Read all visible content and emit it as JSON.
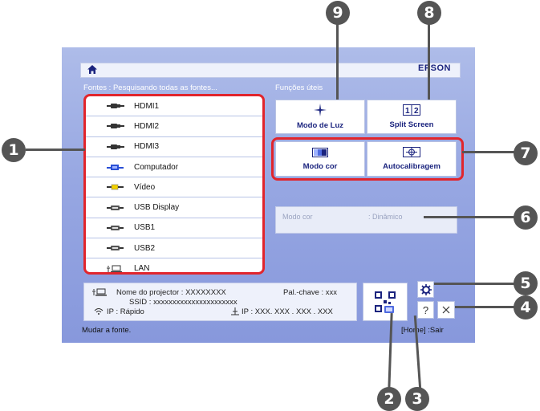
{
  "screen": {
    "brand": "EPSON",
    "sources_label": "Fontes : Pesquisando todas as fontes...",
    "functions_label": "Funções úteis",
    "status_text": "Mudar a fonte.",
    "home_exit": "[Home] :Sair"
  },
  "sources": [
    {
      "label": "HDMI1",
      "icon": "hdmi-icon"
    },
    {
      "label": "HDMI2",
      "icon": "hdmi-icon"
    },
    {
      "label": "HDMI3",
      "icon": "hdmi-icon"
    },
    {
      "label": "Computador",
      "icon": "computer-icon"
    },
    {
      "label": "Vídeo",
      "icon": "video-icon"
    },
    {
      "label": "USB Display",
      "icon": "usb-display-icon"
    },
    {
      "label": "USB1",
      "icon": "usb-icon"
    },
    {
      "label": "USB2",
      "icon": "usb-icon"
    },
    {
      "label": "LAN",
      "icon": "lan-icon"
    }
  ],
  "tiles": {
    "light_mode": "Modo de Luz",
    "split_screen": "Split Screen",
    "color_mode": "Modo cor",
    "auto_calibration": "Autocalibragem"
  },
  "color_mode_row": {
    "label": "Modo cor",
    "value": ": Dinâmico"
  },
  "info": {
    "projector_name": "Nome do projector : XXXXXXXX",
    "passkey": "Pal.-chave : xxx",
    "ssid": "SSID : xxxxxxxxxxxxxxxxxxxxxx",
    "ip_mode": "IP : Rápido",
    "ip_address": "IP : XXX. XXX . XXX . XXX"
  },
  "callouts": [
    "1",
    "2",
    "3",
    "4",
    "5",
    "6",
    "7",
    "8",
    "9"
  ],
  "colors": {
    "red": "#e1252c",
    "navy": "#1a237e",
    "callout": "#555555"
  }
}
